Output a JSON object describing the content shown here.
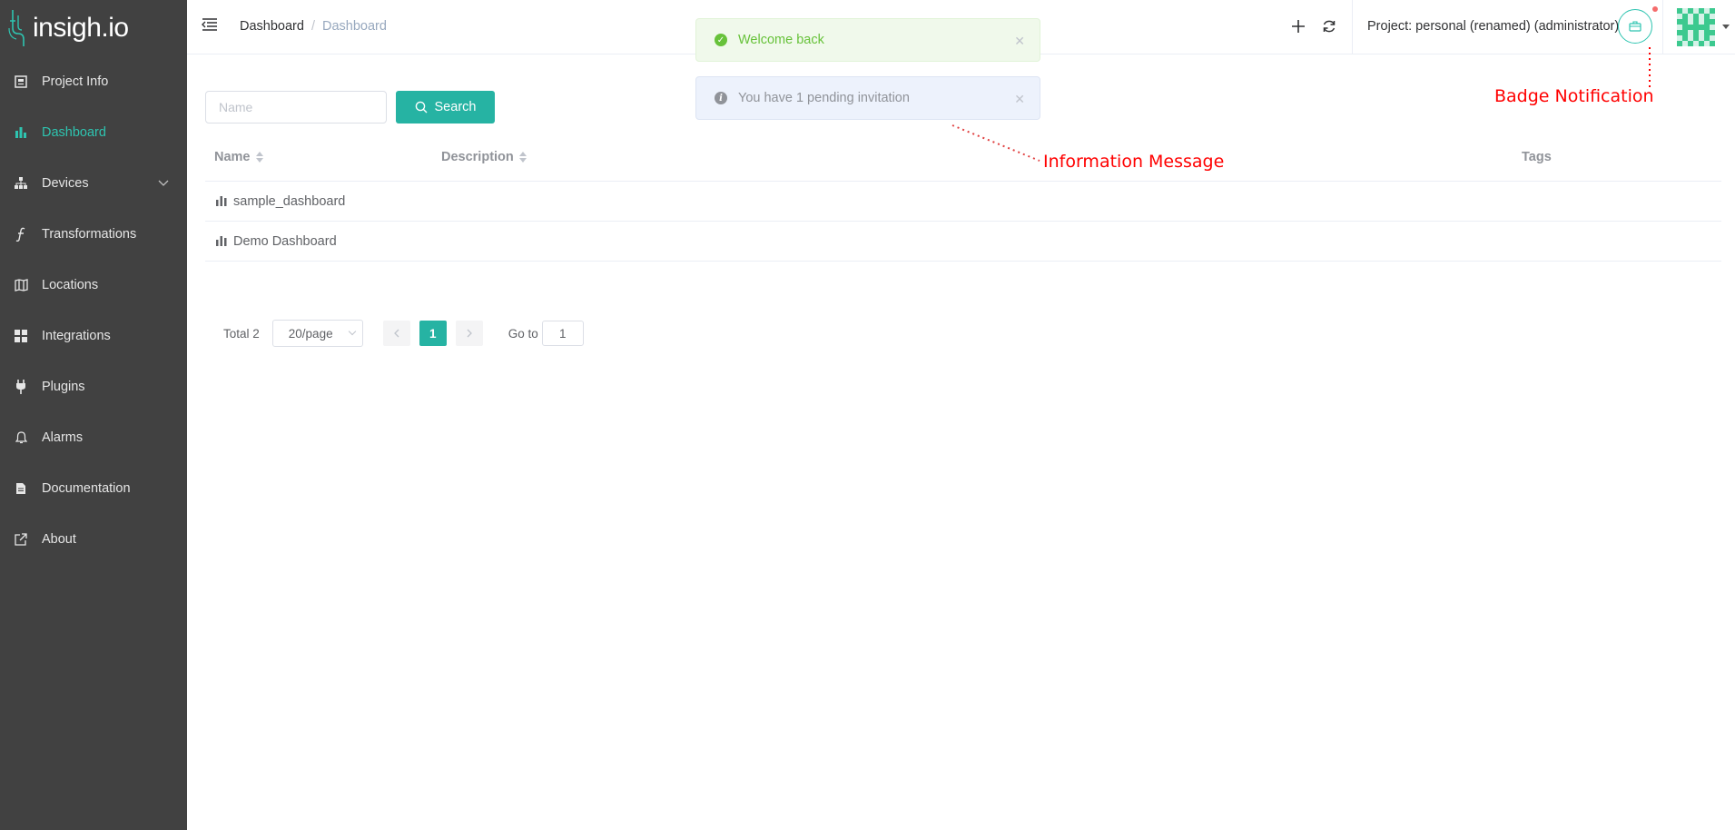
{
  "brand": {
    "logo_text": "insigh.io"
  },
  "sidebar": {
    "items": [
      {
        "label": "Project Info",
        "icon": "project-info-icon"
      },
      {
        "label": "Dashboard",
        "icon": "bar-chart-icon",
        "active": true
      },
      {
        "label": "Devices",
        "icon": "sitemap-icon",
        "expandable": true
      },
      {
        "label": "Transformations",
        "icon": "function-icon"
      },
      {
        "label": "Locations",
        "icon": "map-icon"
      },
      {
        "label": "Integrations",
        "icon": "grid-icon"
      },
      {
        "label": "Plugins",
        "icon": "plug-icon"
      },
      {
        "label": "Alarms",
        "icon": "bell-icon"
      },
      {
        "label": "Documentation",
        "icon": "document-icon"
      },
      {
        "label": "About",
        "icon": "external-link-icon"
      }
    ]
  },
  "header": {
    "breadcrumb": [
      "Dashboard",
      "Dashboard"
    ],
    "breadcrumb_separator": "/",
    "project_label": "Project: personal (renamed) (administrator)"
  },
  "toasts": {
    "success": "Welcome back",
    "info": "You have 1 pending invitation"
  },
  "search": {
    "placeholder": "Name",
    "button_label": "Search"
  },
  "table": {
    "columns": [
      "Name",
      "Description",
      "Tags"
    ],
    "rows": [
      {
        "name": "sample_dashboard",
        "description": "",
        "tags": ""
      },
      {
        "name": "Demo Dashboard",
        "description": "",
        "tags": ""
      }
    ]
  },
  "pagination": {
    "total_label": "Total 2",
    "page_size": "20/page",
    "current_page": "1",
    "goto_label": "Go to",
    "goto_value": "1"
  },
  "annotations": {
    "badge": "Badge Notification",
    "info": "Information Message"
  },
  "colors": {
    "accent": "#26b3a3",
    "sidebar_bg": "#414141",
    "annotation": "#ff0000",
    "badge_dot": "#f56c6c"
  }
}
